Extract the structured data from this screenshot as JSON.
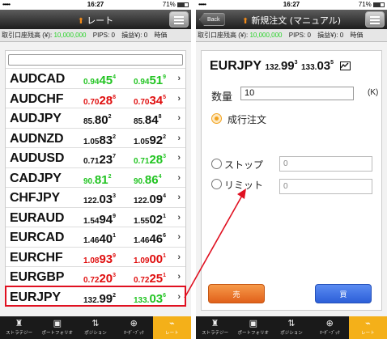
{
  "status": {
    "signal": "•••••",
    "time": "16:27",
    "battery": "71%"
  },
  "ticker": {
    "balance_label": "取引口座残高 (¥):",
    "balance_value": "10,000,000",
    "pips_label": "PIPS:",
    "pips_value": "0",
    "pnl_label": "損益¥):",
    "pnl_value": "0",
    "time_label": "時価"
  },
  "rates_screen": {
    "title": "レート",
    "logo": "⬆",
    "search_placeholder": "",
    "rows": [
      {
        "pair": "AUDCAD",
        "bid_pre": "0.94",
        "bid_big": "45",
        "bid_sup": "4",
        "bid_color": "green",
        "ask_pre": "0.94",
        "ask_big": "51",
        "ask_sup": "9",
        "ask_color": "green"
      },
      {
        "pair": "AUDCHF",
        "bid_pre": "0.70",
        "bid_big": "28",
        "bid_sup": "8",
        "bid_color": "red",
        "ask_pre": "0.70",
        "ask_big": "34",
        "ask_sup": "5",
        "ask_color": "red"
      },
      {
        "pair": "AUDJPY",
        "bid_pre": "85.",
        "bid_big": "80",
        "bid_sup": "2",
        "bid_color": "black",
        "ask_pre": "85.",
        "ask_big": "84",
        "ask_sup": "8",
        "ask_color": "black"
      },
      {
        "pair": "AUDNZD",
        "bid_pre": "1.05",
        "bid_big": "83",
        "bid_sup": "2",
        "bid_color": "black",
        "ask_pre": "1.05",
        "ask_big": "92",
        "ask_sup": "2",
        "ask_color": "black"
      },
      {
        "pair": "AUDUSD",
        "bid_pre": "0.71",
        "bid_big": "23",
        "bid_sup": "7",
        "bid_color": "black",
        "ask_pre": "0.71",
        "ask_big": "28",
        "ask_sup": "3",
        "ask_color": "green"
      },
      {
        "pair": "CADJPY",
        "bid_pre": "90.",
        "bid_big": "81",
        "bid_sup": "2",
        "bid_color": "green",
        "ask_pre": "90.",
        "ask_big": "86",
        "ask_sup": "4",
        "ask_color": "green"
      },
      {
        "pair": "CHFJPY",
        "bid_pre": "122.",
        "bid_big": "03",
        "bid_sup": "3",
        "bid_color": "black",
        "ask_pre": "122.",
        "ask_big": "09",
        "ask_sup": "4",
        "ask_color": "black"
      },
      {
        "pair": "EURAUD",
        "bid_pre": "1.54",
        "bid_big": "94",
        "bid_sup": "9",
        "bid_color": "black",
        "ask_pre": "1.55",
        "ask_big": "02",
        "ask_sup": "1",
        "ask_color": "black"
      },
      {
        "pair": "EURCAD",
        "bid_pre": "1.46",
        "bid_big": "40",
        "bid_sup": "1",
        "bid_color": "black",
        "ask_pre": "1.46",
        "ask_big": "46",
        "ask_sup": "6",
        "ask_color": "black"
      },
      {
        "pair": "EURCHF",
        "bid_pre": "1.08",
        "bid_big": "93",
        "bid_sup": "9",
        "bid_color": "red",
        "ask_pre": "1.09",
        "ask_big": "00",
        "ask_sup": "1",
        "ask_color": "red"
      },
      {
        "pair": "EURGBP",
        "bid_pre": "0.72",
        "bid_big": "20",
        "bid_sup": "3",
        "bid_color": "red",
        "ask_pre": "0.72",
        "ask_big": "25",
        "ask_sup": "1",
        "ask_color": "red"
      },
      {
        "pair": "EURJPY",
        "bid_pre": "132.",
        "bid_big": "99",
        "bid_sup": "2",
        "bid_color": "black",
        "ask_pre": "133.",
        "ask_big": "03",
        "ask_sup": "6",
        "ask_color": "green",
        "highlight": true
      }
    ],
    "chevron": "›"
  },
  "order_screen": {
    "back_label": "Back",
    "title": "新規注文 (マニュアル)",
    "logo": "⬆",
    "pair": "EURJPY",
    "bid_pre": "132.",
    "bid_big": "99",
    "bid_sup": "3",
    "ask_pre": "133.",
    "ask_big": "03",
    "ask_sup": "5",
    "qty_label": "数量",
    "qty_value": "10",
    "qty_unit": "(K)",
    "market_label": "成行注文",
    "stop_label": "ストップ",
    "stop_value": "0",
    "limit_label": "リミット",
    "limit_value": "0",
    "sell_label": "売",
    "buy_label": "買"
  },
  "tabbar": {
    "tabs": [
      {
        "label": "ストラテジー",
        "icon": "♜"
      },
      {
        "label": "ポートフォリオ",
        "icon": "▣"
      },
      {
        "label": "ポジション",
        "icon": "⇅"
      },
      {
        "label": "ｵｰﾀﾞｰﾌﾞｯｸ",
        "icon": "⊕"
      },
      {
        "label": "レート",
        "icon": "⌁"
      }
    ],
    "active_index": 4
  },
  "colors": {
    "green": "#22c422",
    "red": "#e01010",
    "black": "#111111",
    "accent": "#f4b019",
    "highlight": "#e01020"
  }
}
